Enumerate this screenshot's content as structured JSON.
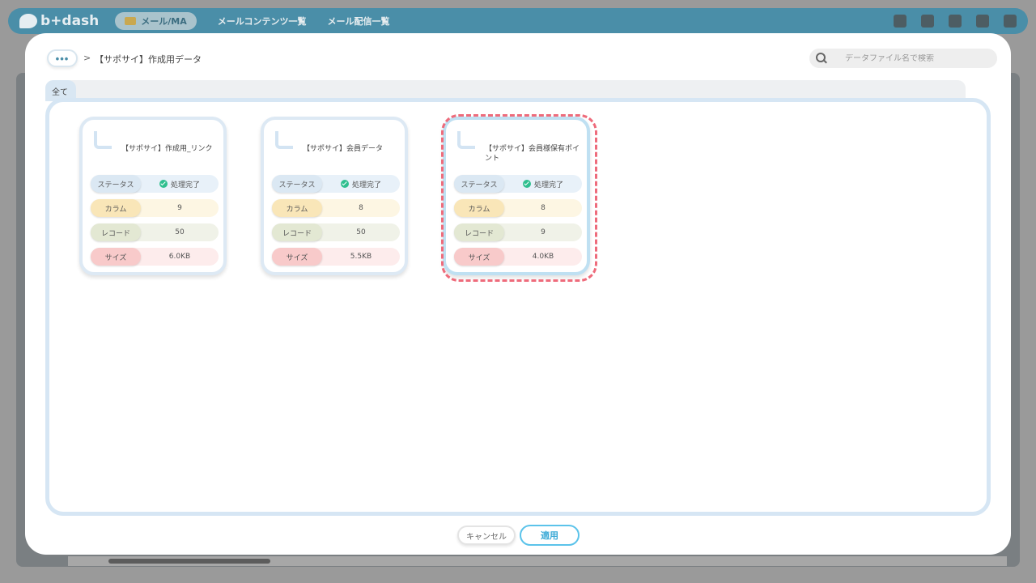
{
  "app": {
    "logo_text": "b+dash",
    "nav": {
      "active_pill": "メール/MA",
      "links": [
        "メールコンテンツ一覧",
        "メール配信一覧"
      ]
    }
  },
  "breadcrumb": {
    "more_label": "•••",
    "separator": ">",
    "current": "【サポサイ】作成用データ"
  },
  "search": {
    "placeholder": "データファイル名で検索"
  },
  "tabs": {
    "all_label": "全て"
  },
  "row_labels": {
    "status": "ステータス",
    "column": "カラム",
    "record": "レコード",
    "size": "サイズ"
  },
  "files": [
    {
      "name": "【サポサイ】作成用_リンク",
      "status": "処理完了",
      "columns": "9",
      "records": "50",
      "size": "6.0KB",
      "selected": false
    },
    {
      "name": "【サポサイ】会員データ",
      "status": "処理完了",
      "columns": "8",
      "records": "50",
      "size": "5.5KB",
      "selected": false
    },
    {
      "name": "【サポサイ】会員様保有ポイント",
      "status": "処理完了",
      "columns": "8",
      "records": "9",
      "size": "4.0KB",
      "selected": true
    }
  ],
  "footer": {
    "cancel_label": "キャンセル",
    "apply_label": "適用"
  },
  "colors": {
    "nav_bg": "#4a8ea8",
    "apply_accent": "#5bc3ea",
    "selection_dash": "#ee6b7b",
    "status_ok": "#2fbf8f"
  }
}
